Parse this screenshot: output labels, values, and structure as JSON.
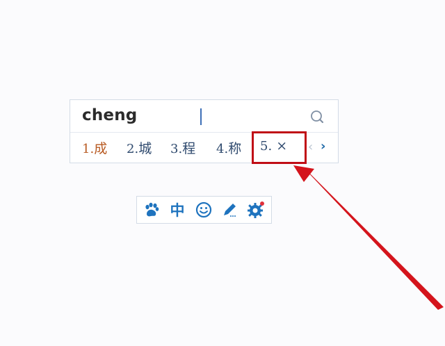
{
  "ime": {
    "composition": "cheng",
    "search_icon": "search-icon",
    "candidates": [
      {
        "num": "1.",
        "text": "成",
        "active": true
      },
      {
        "num": "2.",
        "text": "城",
        "active": false
      },
      {
        "num": "3.",
        "text": "程",
        "active": false
      },
      {
        "num": "4.",
        "text": "称",
        "active": false
      },
      {
        "num": "5.",
        "text": "×",
        "active": false
      }
    ],
    "prev_page": "‹",
    "next_page": "›"
  },
  "toolbar": {
    "items": [
      {
        "name": "paw-icon"
      },
      {
        "name": "chinese-mode-toggle",
        "label": "中"
      },
      {
        "name": "smiley-icon"
      },
      {
        "name": "pen-icon"
      },
      {
        "name": "gear-icon"
      }
    ]
  },
  "colors": {
    "accent": "#1e73be",
    "active_candidate": "#b85a22",
    "candidate": "#2f4a6e",
    "annotation_red": "#c00d16"
  }
}
